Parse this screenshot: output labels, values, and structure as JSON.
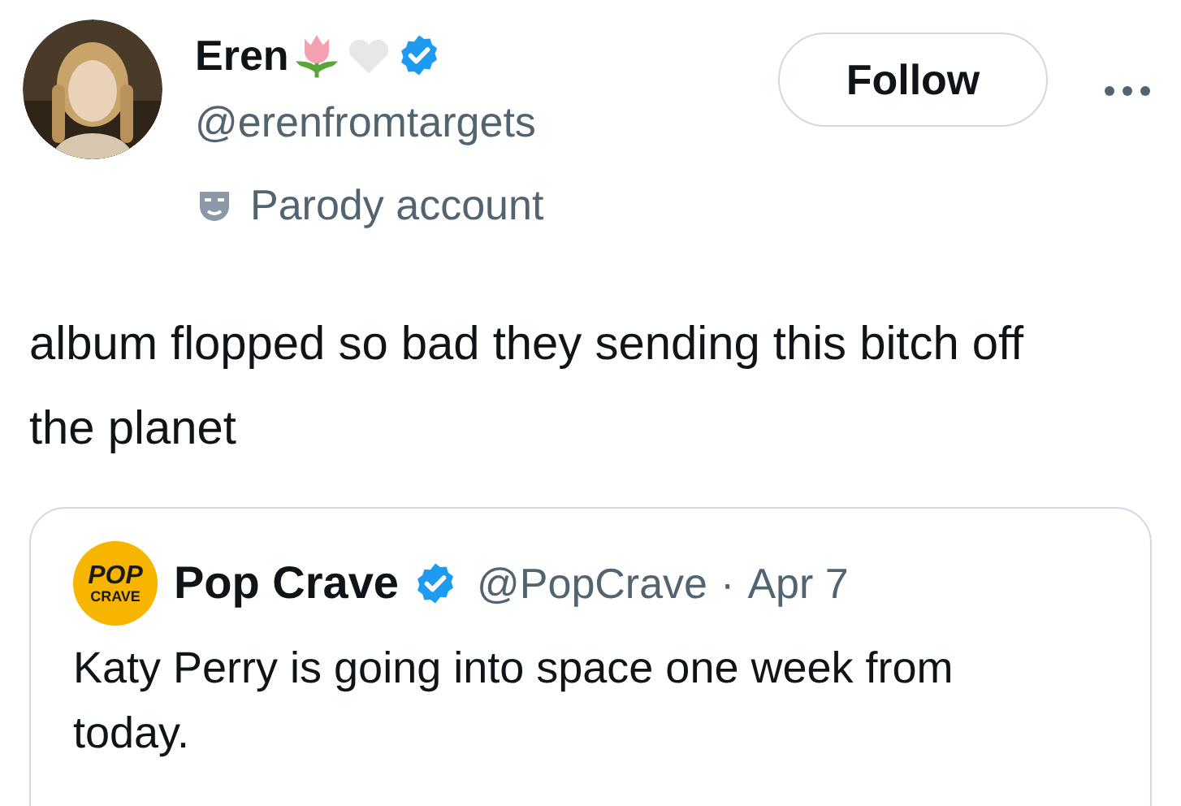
{
  "author": {
    "name": "Eren",
    "handle": "@erenfromtargets",
    "verified": true,
    "label": "Parody account"
  },
  "follow_button": "Follow",
  "text": "album flopped so bad they sending this bitch off the planet",
  "quote": {
    "logo_lines": [
      "POP",
      "CRAVE"
    ],
    "name": "Pop Crave",
    "verified": true,
    "handle": "@PopCrave",
    "separator": "·",
    "date": "Apr 7",
    "text": "Katy Perry is going into space one week from today."
  }
}
